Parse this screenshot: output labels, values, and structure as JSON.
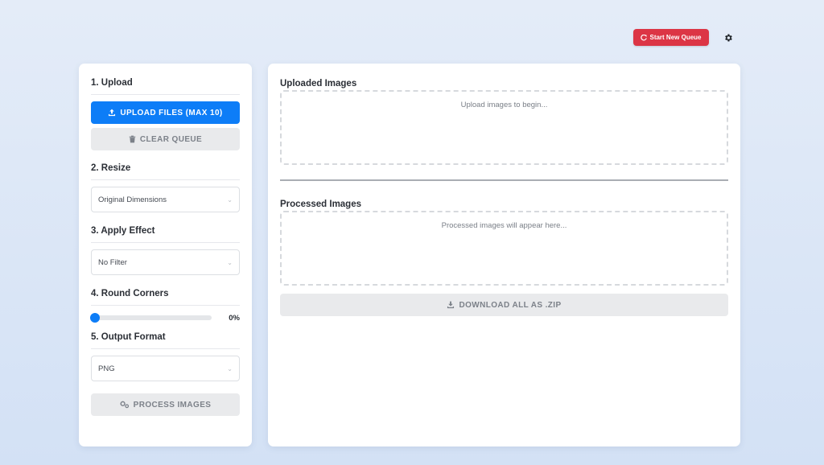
{
  "header": {
    "start_new_queue_label": "Start New Queue",
    "start_icon": "refresh-icon",
    "settings_icon": "gear-icon"
  },
  "left_panel": {
    "upload": {
      "title": "1. Upload",
      "upload_button_label": "UPLOAD FILES (MAX 10)",
      "clear_button_label": "CLEAR QUEUE"
    },
    "resize": {
      "title": "2. Resize",
      "selected": "Original Dimensions"
    },
    "effect": {
      "title": "3. Apply Effect",
      "selected": "No Filter"
    },
    "round_corners": {
      "title": "4. Round Corners",
      "value_label": "0%",
      "value": 0
    },
    "output_format": {
      "title": "5. Output Format",
      "selected": "PNG"
    },
    "process_button_label": "PROCESS IMAGES"
  },
  "right_panel": {
    "uploaded": {
      "title": "Uploaded Images",
      "placeholder": "Upload images to begin..."
    },
    "processed": {
      "title": "Processed Images",
      "placeholder": "Processed images will appear here..."
    },
    "download_button_label": "DOWNLOAD ALL AS .ZIP"
  },
  "colors": {
    "accent": "#0d7df7",
    "danger": "#dc3545"
  }
}
